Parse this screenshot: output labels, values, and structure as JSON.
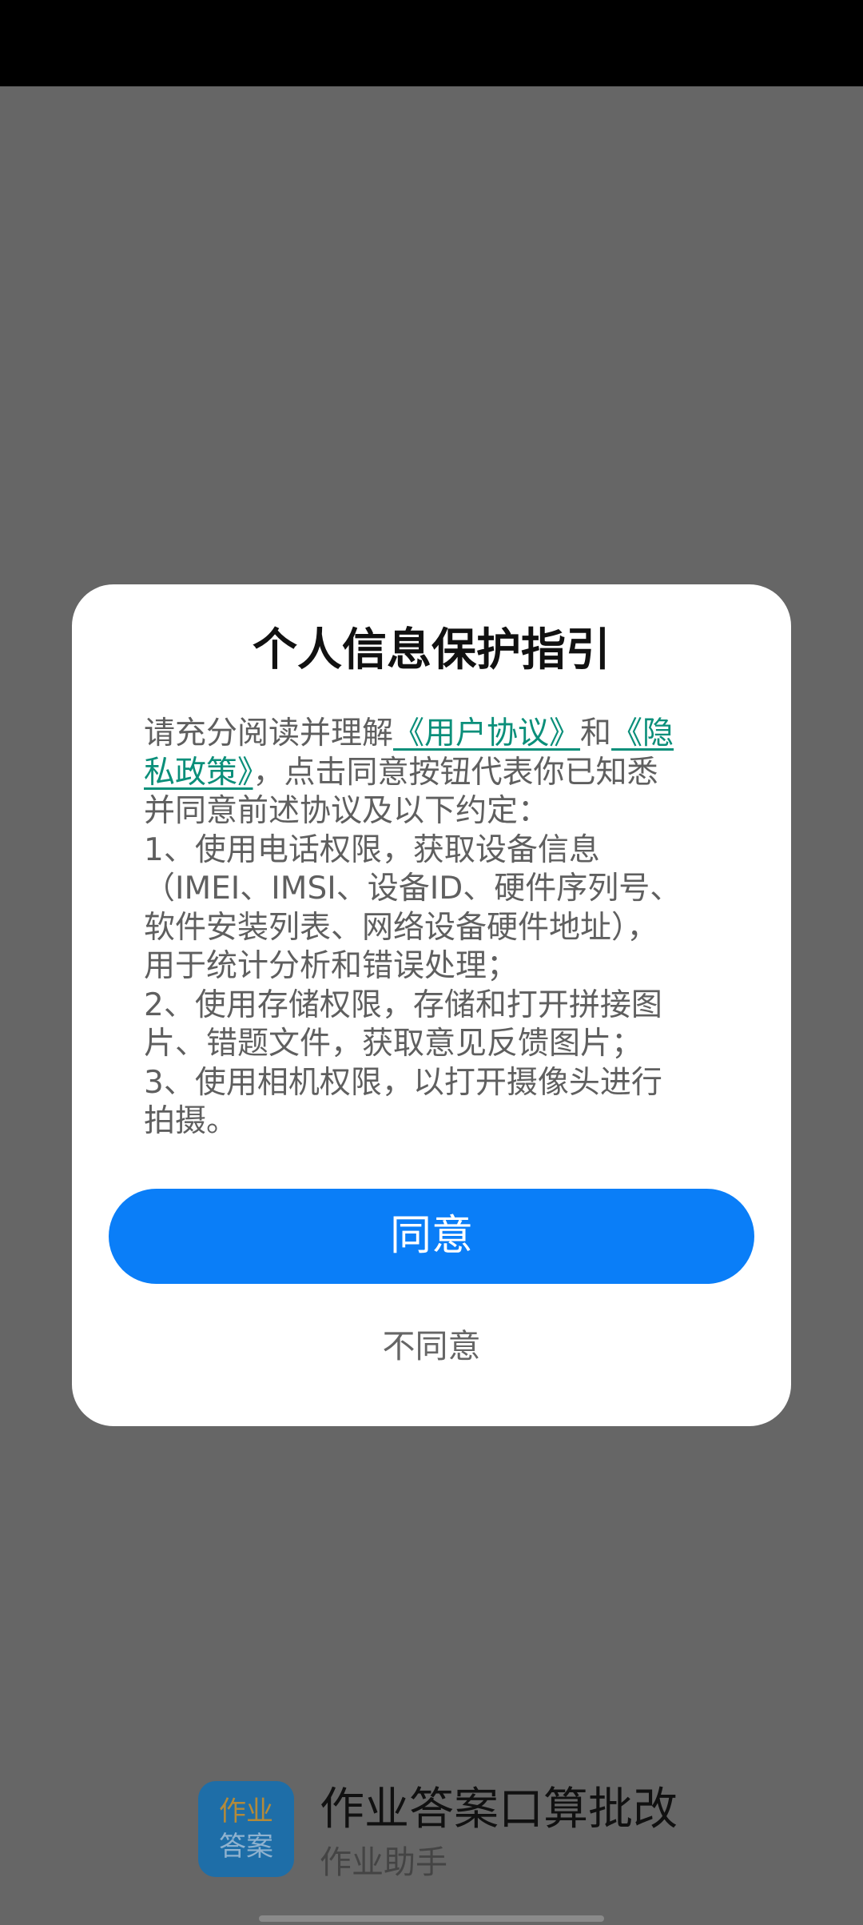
{
  "dialog": {
    "title": "个人信息保护指引",
    "body_segments": {
      "intro": "请充分阅读并理解",
      "user_agreement_link": "《用户协议》",
      "and": "和",
      "privacy_link_part1": "《隐",
      "privacy_link_part2": "私政策》",
      "after_links": "，点击同意按钮代表你已知悉",
      "line3": "并同意前述协议及以下约定：",
      "line4": "1、使用电话权限，获取设备信息",
      "line5": "（IMEI、IMSI、设备ID、硬件序列号、",
      "line6": "软件安装列表、网络设备硬件地址），",
      "line7": "用于统计分析和错误处理；",
      "line8": "2、使用存储权限，存储和打开拼接图",
      "line9": "片、错题文件，获取意见反馈图片；",
      "line10": "3、使用相机权限，以打开摄像头进行",
      "line11": "拍摄。"
    },
    "agree_label": "同意",
    "disagree_label": "不同意"
  },
  "app": {
    "badge_line1": "作业",
    "badge_line2": "答案",
    "name": "作业答案口算批改",
    "subtitle": "作业助手"
  },
  "colors": {
    "primary_button": "#0a7ef8",
    "link": "#0b8f7a",
    "overlay_background": "#666666"
  }
}
